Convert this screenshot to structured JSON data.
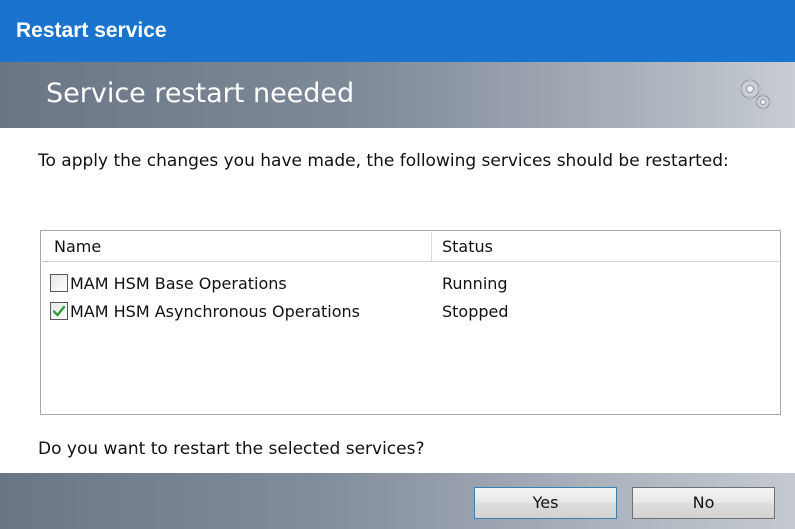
{
  "window": {
    "title": "Restart service"
  },
  "banner": {
    "title": "Service restart needed",
    "icon": "gears-icon"
  },
  "message": "To apply the changes you have made, the following services should be restarted:",
  "services_list": {
    "columns": [
      "Name",
      "Status"
    ],
    "rows": [
      {
        "name": "MAM HSM Base Operations",
        "status": "Running",
        "checked": false
      },
      {
        "name": "MAM HSM Asynchronous Operations",
        "status": "Stopped",
        "checked": true
      }
    ]
  },
  "question": "Do you want to restart the selected services?",
  "buttons": {
    "yes_label": "Yes",
    "no_label": "No"
  },
  "colors": {
    "titlebar": "#1a73cc",
    "checkmark": "#2e9e3a"
  }
}
